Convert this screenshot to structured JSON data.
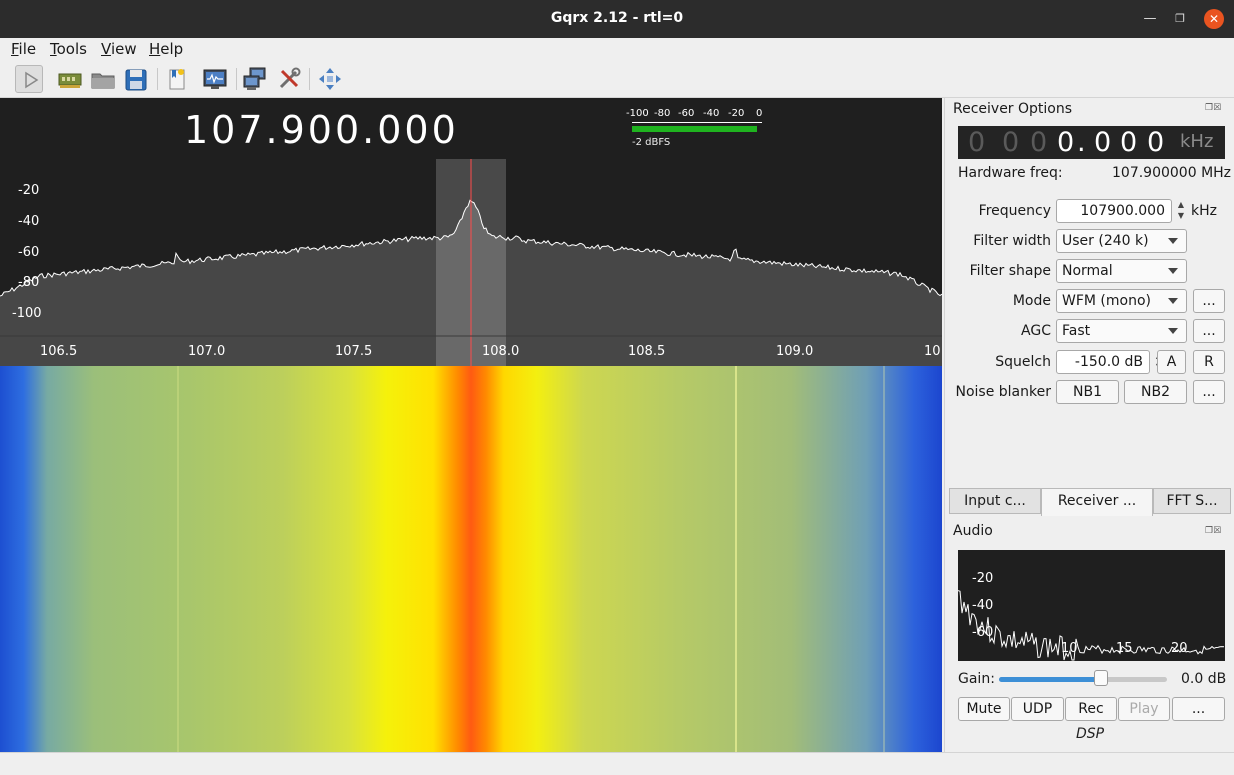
{
  "window": {
    "title": "Gqrx 2.12 - rtl=0",
    "min_icon": "minimize-icon",
    "max_icon": "maximize-icon",
    "close_icon": "close-icon"
  },
  "menu": [
    "File",
    "Tools",
    "View",
    "Help"
  ],
  "toolbar": {
    "icons": [
      "play-icon",
      "device-icon",
      "open-icon",
      "save-icon",
      "bookmark-icon",
      "monitor-icon",
      "network-icon",
      "tools-icon",
      "fullscreen-icon"
    ]
  },
  "spectrum": {
    "frequency_display": "107.900.000",
    "meter_labels": [
      "-100",
      "-80",
      "-60",
      "-40",
      "-20",
      "0"
    ],
    "meter_level": "-2 dBFS",
    "meter_fill": 0.98,
    "y_ticks": [
      "-20",
      "-40",
      "-60",
      "-80",
      "-100"
    ],
    "x_ticks": [
      "106.5",
      "107.0",
      "107.5",
      "108.0",
      "108.5",
      "109.0",
      "10"
    ]
  },
  "receiver_options": {
    "title": "Receiver Options",
    "lcd_dim": [
      "0",
      "0",
      "0"
    ],
    "lcd_bright": [
      "0",
      ".",
      "0",
      "0",
      "0"
    ],
    "lcd_unit": "kHz",
    "hardware_freq_label": "Hardware freq:",
    "hardware_freq_value": "107.900000 MHz",
    "frequency_label": "Frequency",
    "frequency_value": "107900.000",
    "frequency_unit": "kHz",
    "filter_width_label": "Filter width",
    "filter_width_value": "User (240 k)",
    "filter_shape_label": "Filter shape",
    "filter_shape_value": "Normal",
    "mode_label": "Mode",
    "mode_value": "WFM (mono)",
    "agc_label": "AGC",
    "agc_value": "Fast",
    "squelch_label": "Squelch",
    "squelch_value": "-150.0 dB",
    "squelch_a": "A",
    "squelch_r": "R",
    "noise_blanker_label": "Noise blanker",
    "nb1": "NB1",
    "nb2": "NB2",
    "more": "..."
  },
  "tabs": [
    {
      "label": "Input c...",
      "active": false
    },
    {
      "label": "Receiver ...",
      "active": true
    },
    {
      "label": "FFT S...",
      "active": false
    }
  ],
  "audio": {
    "title": "Audio",
    "y_ticks": [
      "-20",
      "-40",
      "-60"
    ],
    "x_ticks": [
      "10",
      "15",
      "20"
    ],
    "gain_label": "Gain:",
    "gain_value": "0.0 dB",
    "gain_fraction": 0.61,
    "mute": "Mute",
    "udp": "UDP",
    "rec": "Rec",
    "play": "Play",
    "more": "...",
    "dsp": "DSP"
  }
}
